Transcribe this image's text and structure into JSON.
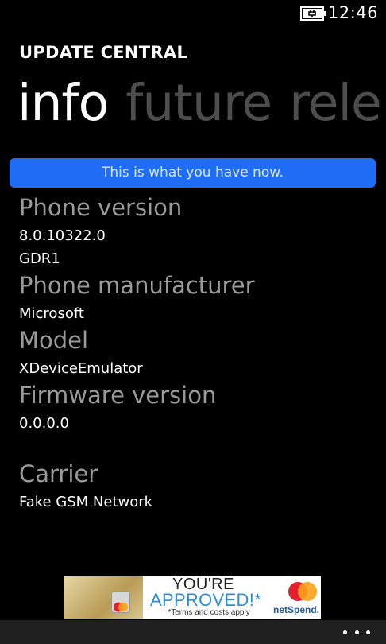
{
  "status_bar": {
    "battery_icon": "battery-charging-icon",
    "time": "12:46"
  },
  "app": {
    "title": "UPDATE CENTRAL"
  },
  "pivot": {
    "items": [
      "info",
      "future",
      "rele"
    ],
    "active_index": 0
  },
  "banner": {
    "text": "This is what you have now.",
    "color": "#1f6cf5"
  },
  "info": {
    "phone_version_label": "Phone version",
    "phone_version_value": "8.0.10322.0",
    "phone_version_name": "GDR1",
    "manufacturer_label": "Phone manufacturer",
    "manufacturer_value": "Microsoft",
    "model_label": "Model",
    "model_value": "XDeviceEmulator",
    "firmware_label": "Firmware version",
    "firmware_value": "0.0.0.0",
    "carrier_label": "Carrier",
    "carrier_value": "Fake GSM Network"
  },
  "ad": {
    "headline": "YOU'RE",
    "subheadline": "APPROVED!*",
    "terms": "*Terms and costs apply",
    "brand": "netSpend.",
    "logo_icon": "mastercard-logo-icon"
  },
  "app_bar": {
    "more_icon": "more-ellipsis-icon"
  }
}
